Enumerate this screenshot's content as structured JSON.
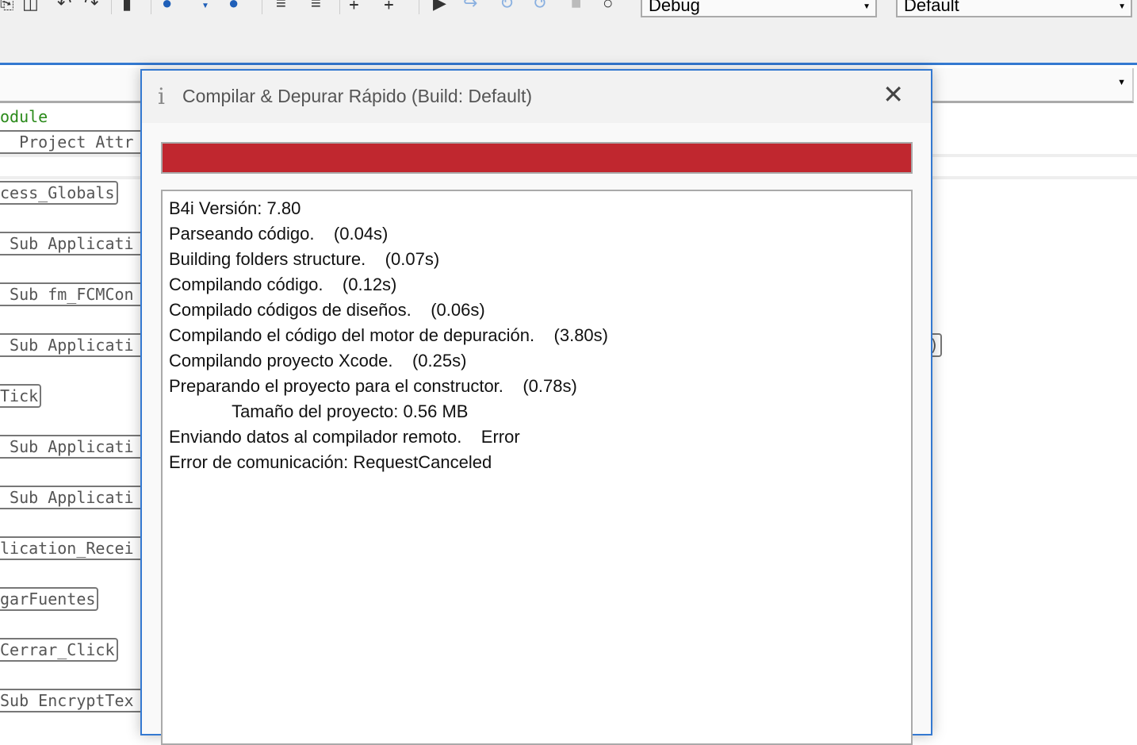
{
  "toolbar": {
    "icons": [
      "copy-icon",
      "paste-icon",
      "undo-icon",
      "redo-icon",
      "bookmark-icon",
      "back-icon",
      "dropdown-icon",
      "forward-icon",
      "indent-icon",
      "outdent-icon",
      "comment-icon",
      "uncomment-icon",
      "run-icon",
      "step-in-icon",
      "step-over-icon",
      "step-out-icon",
      "stop-icon",
      "restart-icon"
    ],
    "build_mode": "Debug",
    "build_config": "Default"
  },
  "editor": {
    "code_lines": [
      "odule",
      "  Project Attr",
      "cess_Globals",
      " Sub Applicati",
      " Sub fm_FCMCon",
      " Sub Applicati",
      "Tick",
      " Sub Applicati",
      " Sub Applicati",
      "lication_Recei",
      "garFuentes",
      "Cerrar_Click",
      "Sub EncryptTex"
    ],
    "right_fragment": ")"
  },
  "dialog": {
    "title": "Compilar & Depurar Rápido (Build: Default)",
    "info_icon": "i",
    "close_icon": "✕",
    "progress_percent": 100,
    "progress_color": "#c0272f",
    "log": [
      "B4i Versión: 7.80",
      "Parseando código.    (0.04s)",
      "Building folders structure.    (0.07s)",
      "Compilando código.    (0.12s)",
      "Compilado códigos de diseños.    (0.06s)",
      "Compilando el código del motor de depuración.    (3.80s)",
      "Compilando proyecto Xcode.    (0.25s)",
      "Preparando el proyecto para el constructor.    (0.78s)",
      "             Tamaño del proyecto: 0.56 MB",
      "Enviando datos al compilador remoto.    Error",
      "Error de comunicación: RequestCanceled"
    ]
  }
}
